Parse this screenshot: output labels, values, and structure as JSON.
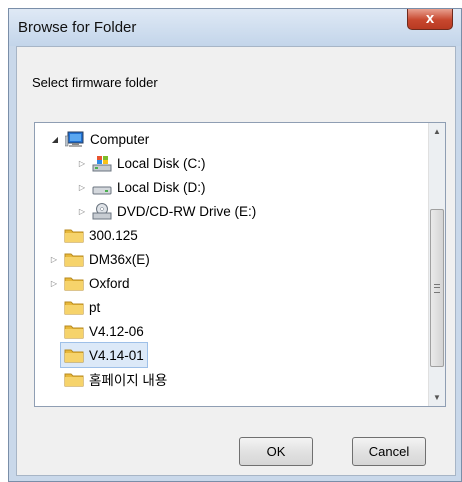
{
  "window": {
    "title": "Browse for Folder",
    "close_label": "x"
  },
  "description": "Select firmware folder",
  "tree": {
    "items": [
      {
        "label": "Computer",
        "icon": "computer-icon",
        "expanded": true
      },
      {
        "label": "Local Disk (C:)",
        "icon": "windows-drive-icon"
      },
      {
        "label": "Local Disk (D:)",
        "icon": "drive-icon"
      },
      {
        "label": "DVD/CD-RW Drive (E:)",
        "icon": "dvd-drive-icon"
      },
      {
        "label": "300.125",
        "icon": "folder-icon"
      },
      {
        "label": "DM36x(E)",
        "icon": "folder-icon"
      },
      {
        "label": "Oxford",
        "icon": "folder-icon"
      },
      {
        "label": "pt",
        "icon": "folder-icon"
      },
      {
        "label": "V4.12-06",
        "icon": "folder-icon"
      },
      {
        "label": "V4.14-01",
        "icon": "folder-icon",
        "selected": true
      },
      {
        "label": "홈페이지 내용",
        "icon": "folder-icon"
      }
    ]
  },
  "buttons": {
    "ok": "OK",
    "cancel": "Cancel"
  },
  "colors": {
    "selection": "#dce9f8",
    "close": "#c7472e",
    "frame": "#c9d8ea"
  }
}
